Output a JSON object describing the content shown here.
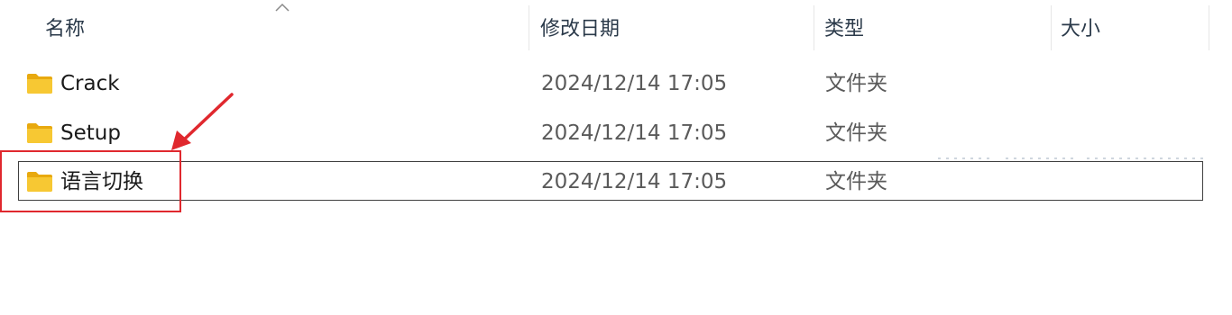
{
  "columns": {
    "name": "名称",
    "date_modified": "修改日期",
    "type": "类型",
    "size": "大小"
  },
  "sort": {
    "column": "name",
    "icon": "chevron-up-icon"
  },
  "files": [
    {
      "name": "Crack",
      "date_modified": "2024/12/14 17:05",
      "type": "文件夹",
      "icon": "folder-icon"
    },
    {
      "name": "Setup",
      "date_modified": "2024/12/14 17:05",
      "type": "文件夹",
      "icon": "folder-icon"
    },
    {
      "name": "语言切换",
      "date_modified": "2024/12/14 17:05",
      "type": "文件夹",
      "icon": "folder-icon",
      "focused": true
    }
  ],
  "colors": {
    "annotation": "#e0282e",
    "folder_yellow": "#f5c518",
    "header_text": "#2b3a4a",
    "secondary_text": "#5a5a5a"
  }
}
